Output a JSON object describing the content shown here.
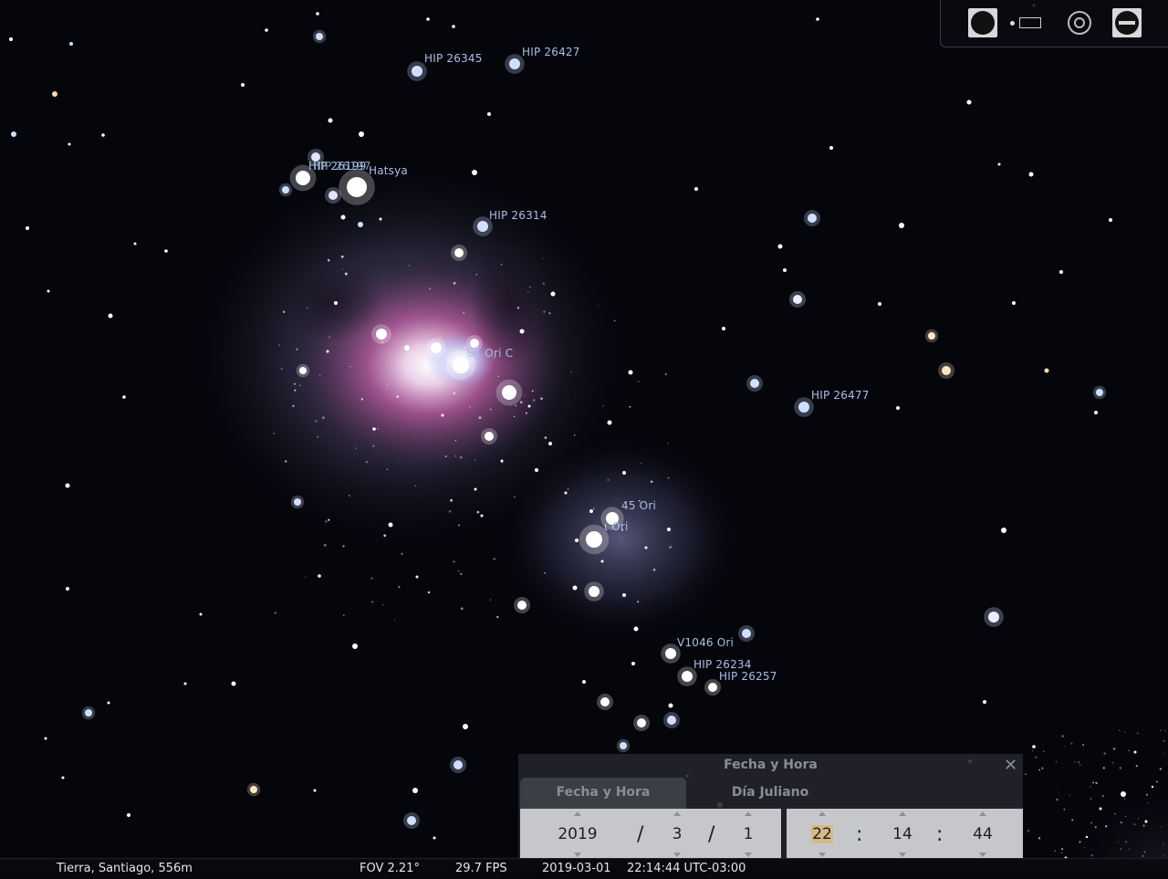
{
  "labels": [
    {
      "text": "HIP 26345"
    },
    {
      "text": "HIP 26427"
    },
    {
      "text": "HIP 26199"
    },
    {
      "text": "HIP 26197"
    },
    {
      "text": "Hatsya"
    },
    {
      "text": "HIP 26314"
    },
    {
      "text": "θ1 Ori C"
    },
    {
      "text": "HIP 26477"
    },
    {
      "text": "45 Ori"
    },
    {
      "text": "ι Ori"
    },
    {
      "text": "V1046 Ori"
    },
    {
      "text": "HIP 26234"
    },
    {
      "text": "HIP 26257"
    }
  ],
  "toolbar": {
    "buttons": [
      {
        "name": "moon-icon"
      },
      {
        "name": "window-icon"
      },
      {
        "name": "target-icon"
      },
      {
        "name": "wrench-icon"
      }
    ]
  },
  "status": {
    "location": "Tierra, Santiago, 556m",
    "fov": "FOV 2.21°",
    "fps": "29.7 FPS",
    "date": "2019-03-01",
    "time": "22:14:44 UTC-03:00"
  },
  "dialog": {
    "title": "Fecha y Hora",
    "close": "✕",
    "tabs": [
      "Fecha y Hora",
      "Día Juliano"
    ],
    "year": "2019",
    "month": "3",
    "day": "1",
    "hour": "22",
    "minute": "14",
    "second": "44",
    "date_sep": "/",
    "time_sep": ":"
  }
}
